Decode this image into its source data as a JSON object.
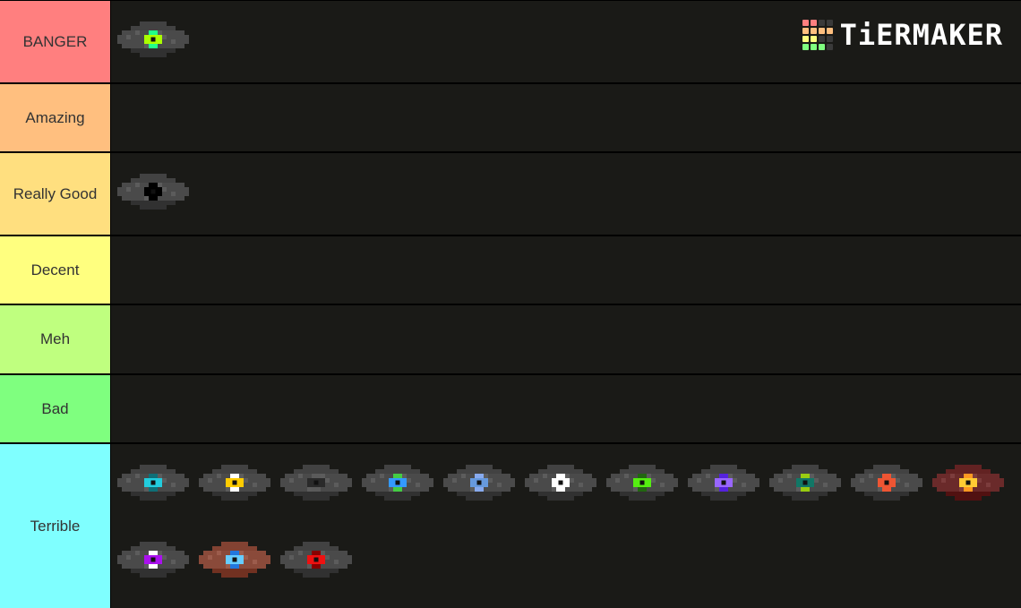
{
  "logo": {
    "text": "TiERMAKER",
    "grid_colors": [
      "#ff7f7f",
      "#ff7f7f",
      "#3a3a3a",
      "#3a3a3a",
      "#ffbf7f",
      "#ffbf7f",
      "#ffbf7f",
      "#ffbf7f",
      "#ffff7f",
      "#ffff7f",
      "#3a3a3a",
      "#3a3a3a",
      "#7fff7f",
      "#7fff7f",
      "#7fff7f",
      "#3a3a3a"
    ]
  },
  "tiers": [
    {
      "label": "BANGER",
      "color": "#ff7f7f",
      "discs": [
        {
          "name": "music-disc-otherside",
          "body": "#4a4a4a",
          "center": "#aaff00",
          "accent": "#22ff88"
        }
      ]
    },
    {
      "label": "Amazing",
      "color": "#ffbf7f",
      "discs": []
    },
    {
      "label": "Really Good",
      "color": "#ffdf7f",
      "discs": [
        {
          "name": "music-disc-11",
          "body": "#4a4a4a",
          "center": "#000000",
          "accent": "#000000"
        }
      ]
    },
    {
      "label": "Decent",
      "color": "#ffff7f",
      "discs": []
    },
    {
      "label": "Meh",
      "color": "#bfff7f",
      "discs": []
    },
    {
      "label": "Bad",
      "color": "#7fff7f",
      "discs": []
    },
    {
      "label": "Terrible",
      "color": "#7fffff",
      "discs": [
        {
          "name": "music-disc-5",
          "body": "#4a4a4a",
          "center": "#22ccdd",
          "accent": "#0f6f77"
        },
        {
          "name": "music-disc-13",
          "body": "#4a4a4a",
          "center": "#ffcc00",
          "accent": "#ffffff"
        },
        {
          "name": "music-disc-fragment",
          "body": "#4a4a4a",
          "center": "#2a2a2a",
          "accent": "#5a5a5a"
        },
        {
          "name": "music-disc-cat",
          "body": "#4a4a4a",
          "center": "#3399ff",
          "accent": "#44cc44"
        },
        {
          "name": "music-disc-wait",
          "body": "#4a4a4a",
          "center": "#6699dd",
          "accent": "#88aaee"
        },
        {
          "name": "music-disc-stal",
          "body": "#4a4a4a",
          "center": "#ffffff",
          "accent": "#ffffff"
        },
        {
          "name": "music-disc-mall",
          "body": "#4a4a4a",
          "center": "#55ee11",
          "accent": "#226611"
        },
        {
          "name": "music-disc-far",
          "body": "#4a4a4a",
          "center": "#9966ff",
          "accent": "#5522dd"
        },
        {
          "name": "music-disc-strad",
          "body": "#4a4a4a",
          "center": "#117766",
          "accent": "#99cc11"
        },
        {
          "name": "music-disc-blocks",
          "body": "#4a4a4a",
          "center": "#ee5533",
          "accent": "#ee5533"
        },
        {
          "name": "music-disc-pigstep",
          "body": "#6a2a2a",
          "center": "#ffcc33",
          "accent": "#ff9922"
        },
        {
          "name": "music-disc-mellohi",
          "body": "#4a4a4a",
          "center": "#aa11ee",
          "accent": "#ffffff"
        },
        {
          "name": "music-disc-relic",
          "body": "#8a4a3a",
          "center": "#66ccff",
          "accent": "#2277dd"
        },
        {
          "name": "music-disc-chirp",
          "body": "#4a4a4a",
          "center": "#ee1111",
          "accent": "#880000"
        }
      ]
    }
  ]
}
